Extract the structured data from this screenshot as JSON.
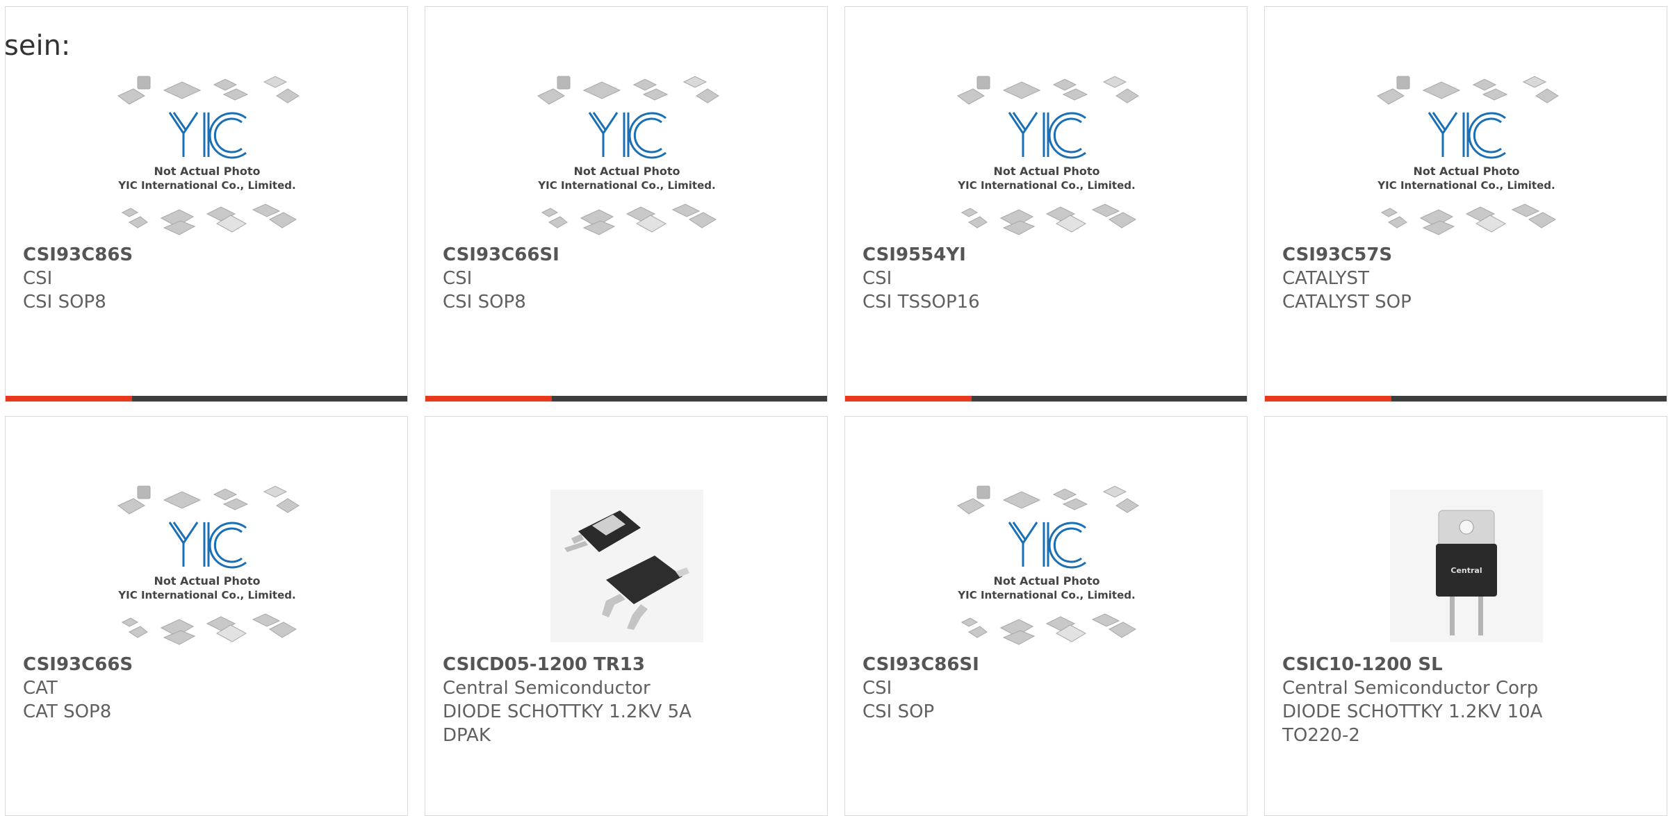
{
  "lead_text": "sein:",
  "colors": {
    "accent_bar": "#e8391d",
    "dark_bar": "#3d3d3d",
    "logo_blue": "#1a6fb5"
  },
  "placeholder": {
    "caption_line1": "Not Actual Photo",
    "caption_line2": "YIC International Co., Limited.",
    "logo_text": "YIC"
  },
  "products": [
    {
      "part": "CSI93C86S",
      "brand": "CSI",
      "desc": "CSI SOP8",
      "image": "yic-placeholder",
      "bar": true
    },
    {
      "part": "CSI93C66SI",
      "brand": "CSI",
      "desc": "CSI SOP8",
      "image": "yic-placeholder",
      "bar": true
    },
    {
      "part": "CSI9554YI",
      "brand": "CSI",
      "desc": "CSI TSSOP16",
      "image": "yic-placeholder",
      "bar": true
    },
    {
      "part": "CSI93C57S",
      "brand": "CATALYST",
      "desc": "CATALYST SOP",
      "image": "yic-placeholder",
      "bar": true
    },
    {
      "part": "CSI93C66S",
      "brand": "CAT",
      "desc": "CAT SOP8",
      "image": "yic-placeholder",
      "bar": false
    },
    {
      "part": "CSICD05-1200 TR13",
      "brand": "Central Semiconductor",
      "desc": "DIODE SCHOTTKY 1.2KV 5A",
      "desc2": "DPAK",
      "image": "dpak-photo",
      "bar": false
    },
    {
      "part": "CSI93C86SI",
      "brand": "CSI",
      "desc": "CSI SOP",
      "image": "yic-placeholder",
      "bar": false
    },
    {
      "part": "CSIC10-1200 SL",
      "brand": "Central Semiconductor Corp",
      "desc": "DIODE SCHOTTKY 1.2KV 10A",
      "desc2": "TO220-2",
      "image": "to220-photo",
      "bar": false
    }
  ],
  "to220_label": "Central"
}
